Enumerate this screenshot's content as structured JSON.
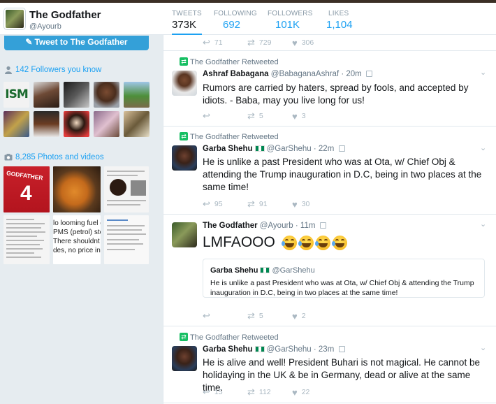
{
  "profile": {
    "name": "The Godfather",
    "handle": "@Ayourb"
  },
  "stats": [
    {
      "label": "TWEETS",
      "value": "373K"
    },
    {
      "label": "FOLLOWING",
      "value": "692"
    },
    {
      "label": "FOLLOWERS",
      "value": "101K"
    },
    {
      "label": "LIKES",
      "value": "1,104"
    }
  ],
  "sidebar": {
    "tweet_to_label": "Tweet to The Godfather",
    "followers_you_know": "142 Followers you know",
    "photos_videos": "8,285 Photos and videos",
    "ism_text": "ISM",
    "jersey_text": "GODFATHER",
    "jersey_number": "4",
    "fuel_lines": [
      "lo looming fuel cr",
      "PMS (petrol) stoc",
      "There shouldnt be",
      "des, no price incr"
    ]
  },
  "timeline": {
    "top_actions": {
      "replies": "71",
      "retweets": "729",
      "likes": "306"
    },
    "tweets": [
      {
        "retweeted_by": "The Godfather Retweeted",
        "name": "Ashraf Babagana",
        "handle": "@BabaganaAshraf",
        "time": "· 20m",
        "text": "Rumors are carried by haters, spread by fools, and accepted by idiots. - Baba, may you live long for us!",
        "replies": "",
        "retweets": "5",
        "likes": "3"
      },
      {
        "retweeted_by": "The Godfather Retweeted",
        "name": "Garba Shehu",
        "handle": "@GarShehu",
        "time": "· 22m",
        "text": "He is unlike a past President who was at Ota, w/ Chief Obj & attending the Trump inauguration in D.C, being in two places at the same time!",
        "replies": "95",
        "retweets": "91",
        "likes": "30"
      },
      {
        "name": "The Godfather",
        "handle": "@Ayourb",
        "time": "· 11m",
        "text": "LMFAOOO",
        "quote": {
          "name": "Garba Shehu",
          "handle": "@GarShehu",
          "text": "He is unlike a past President who was at Ota, w/ Chief Obj & attending the Trump inauguration in D.C, being in two places at the same time!"
        },
        "replies": "",
        "retweets": "5",
        "likes": "2"
      },
      {
        "retweeted_by": "The Godfather Retweeted",
        "name": "Garba Shehu",
        "handle": "@GarShehu",
        "time": "· 23m",
        "text": "He is alive and well! President Buhari is not magical. He cannot be holidaying in the UK & be in Germany, dead or alive at the same time.",
        "replies": "15",
        "retweets": "112",
        "likes": "22"
      }
    ]
  },
  "colors": {
    "accent": "#1da1f2",
    "retweet_green": "#17bf63",
    "button_blue": "#34a0d8"
  }
}
